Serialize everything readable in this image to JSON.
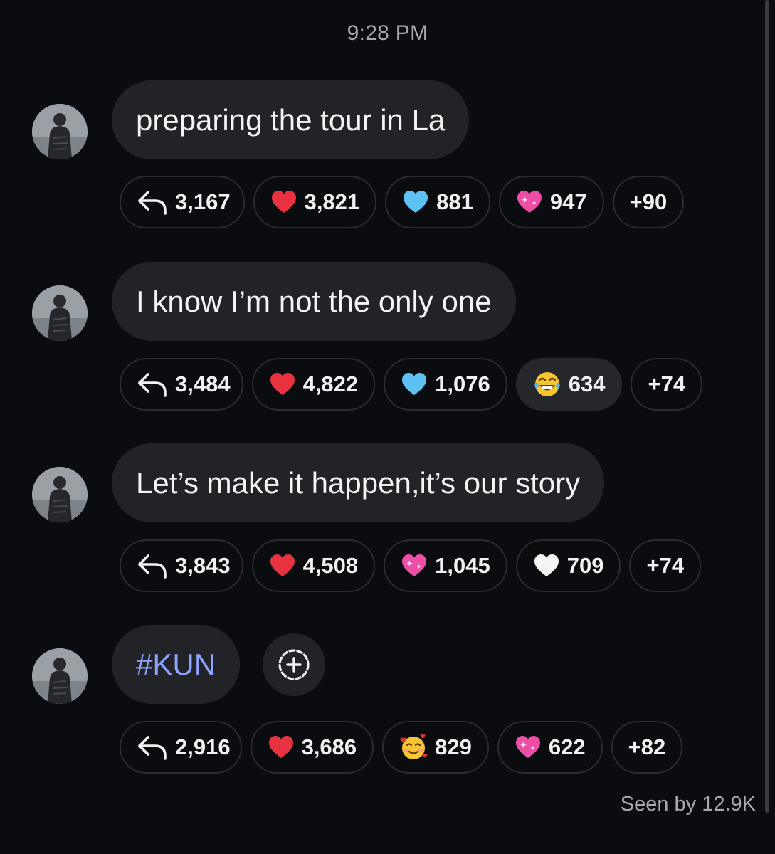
{
  "header": {
    "timestamp": "9:28 PM"
  },
  "messages": [
    {
      "text": "preparing the tour in La",
      "reactions": [
        {
          "icon": "reply-icon",
          "count": "3,167"
        },
        {
          "icon": "red-heart-icon",
          "count": "3,821"
        },
        {
          "icon": "blue-heart-icon",
          "count": "881"
        },
        {
          "icon": "sparkling-pink-heart-icon",
          "count": "947"
        },
        {
          "icon": "",
          "count": "+90"
        }
      ]
    },
    {
      "text": "I know I’m not the only one",
      "reactions": [
        {
          "icon": "reply-icon",
          "count": "3,484"
        },
        {
          "icon": "red-heart-icon",
          "count": "4,822"
        },
        {
          "icon": "blue-heart-icon",
          "count": "1,076"
        },
        {
          "icon": "tears-of-joy-icon",
          "count": "634"
        },
        {
          "icon": "",
          "count": "+74"
        }
      ]
    },
    {
      "text": "Let’s make it happen,it’s our story",
      "reactions": [
        {
          "icon": "reply-icon",
          "count": "3,843"
        },
        {
          "icon": "red-heart-icon",
          "count": "4,508"
        },
        {
          "icon": "sparkling-pink-heart-icon",
          "count": "1,045"
        },
        {
          "icon": "white-heart-icon",
          "count": "709"
        },
        {
          "icon": "",
          "count": "+74"
        }
      ]
    },
    {
      "text": "#KUN",
      "reactions": [
        {
          "icon": "reply-icon",
          "count": "2,916"
        },
        {
          "icon": "red-heart-icon",
          "count": "3,686"
        },
        {
          "icon": "smiling-face-with-hearts-icon",
          "count": "829"
        },
        {
          "icon": "sparkling-pink-heart-icon",
          "count": "622"
        },
        {
          "icon": "",
          "count": "+82"
        }
      ]
    }
  ],
  "footer": {
    "seen": "Seen by 12.9K"
  },
  "colors": {
    "background": "#0b0c0f",
    "bubble": "#222327",
    "hashtag": "#8ea2ff",
    "muted_text": "#a7a9ae"
  }
}
